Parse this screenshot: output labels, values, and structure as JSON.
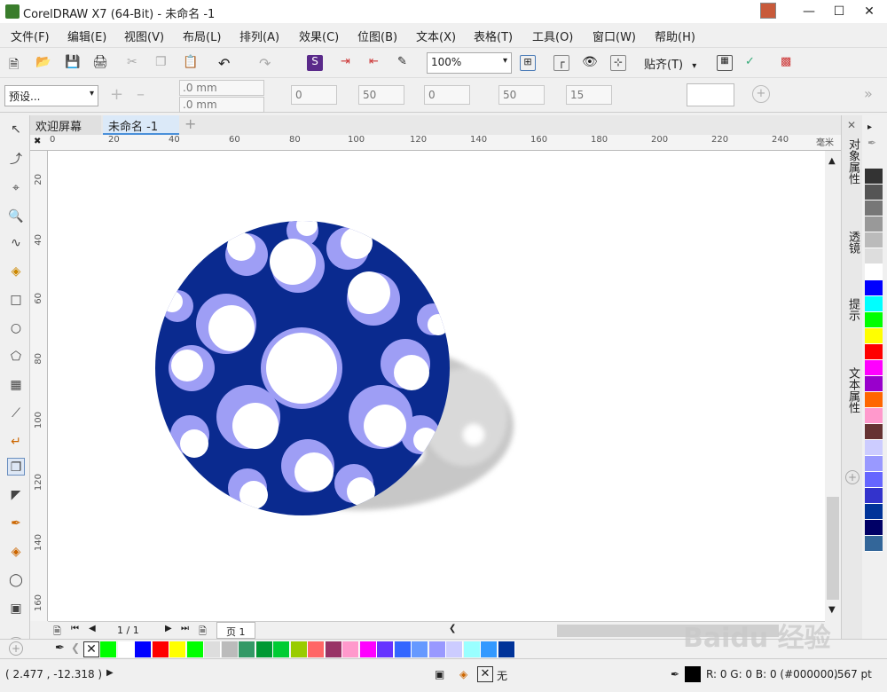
{
  "window": {
    "title": "CorelDRAW X7 (64-Bit) - 未命名 -1"
  },
  "menu": [
    "文件(F)",
    "编辑(E)",
    "视图(V)",
    "布局(L)",
    "排列(A)",
    "效果(C)",
    "位图(B)",
    "文本(X)",
    "表格(T)",
    "工具(O)",
    "窗口(W)",
    "帮助(H)"
  ],
  "toolbar": {
    "zoom_value": "100%",
    "snap_label": "贴齐(T)"
  },
  "propbar": {
    "preset": "预设...",
    "width_value": ".0 mm",
    "height_value": ".0 mm",
    "field_1": "0",
    "field_2": "50",
    "field_3": "0",
    "field_4": "50",
    "field_5": "15"
  },
  "tabs": [
    "欢迎屏幕",
    "未命名 -1"
  ],
  "ruler": {
    "unit": "毫米",
    "h_labels": [
      "0",
      "20",
      "40",
      "60",
      "80",
      "100",
      "120",
      "140",
      "160",
      "180",
      "200",
      "220",
      "240"
    ],
    "v_labels": [
      "20",
      "40",
      "60",
      "80",
      "100",
      "120",
      "140",
      "160"
    ]
  },
  "docker_tabs": [
    "对象属性",
    "透镜",
    "提示",
    "文本属性"
  ],
  "pagebar": {
    "page_count": "1 / 1",
    "page_tab": "页 1"
  },
  "palette_colors": {
    "right": [
      "#333333",
      "#555555",
      "#777777",
      "#999999",
      "#bbbbbb",
      "#dddddd",
      "#ffffff",
      "#0000ff",
      "#00ffff",
      "#00ff00",
      "#ffff00",
      "#ff0000",
      "#ff00ff",
      "#9900cc",
      "#ff6600",
      "#ff99cc",
      "#663333",
      "#ccccff",
      "#9999ff",
      "#6666ff",
      "#3333cc",
      "#003399",
      "#000066",
      "#336699"
    ],
    "bottom": [
      "#00ff00",
      "#ffffff",
      "#0000ff",
      "#ff0000",
      "#ffff00",
      "#00ff00",
      "#dddddd",
      "#bbbbbb",
      "#339966",
      "#009933",
      "#00cc33",
      "#99cc00",
      "#ff6666",
      "#993366",
      "#ff99cc",
      "#ff00ff",
      "#6633ff",
      "#3366ff",
      "#6699ff",
      "#9999ff",
      "#ccccff",
      "#99ffff",
      "#3399ff",
      "#003399"
    ]
  },
  "status": {
    "coords": "( 2.477 , -12.318 )",
    "fill_none": "无",
    "color_readout": "R: 0 G: 0 B: 0 (#000000)",
    "outline_width": ".567 pt"
  },
  "watermark": "Baidu 经验"
}
